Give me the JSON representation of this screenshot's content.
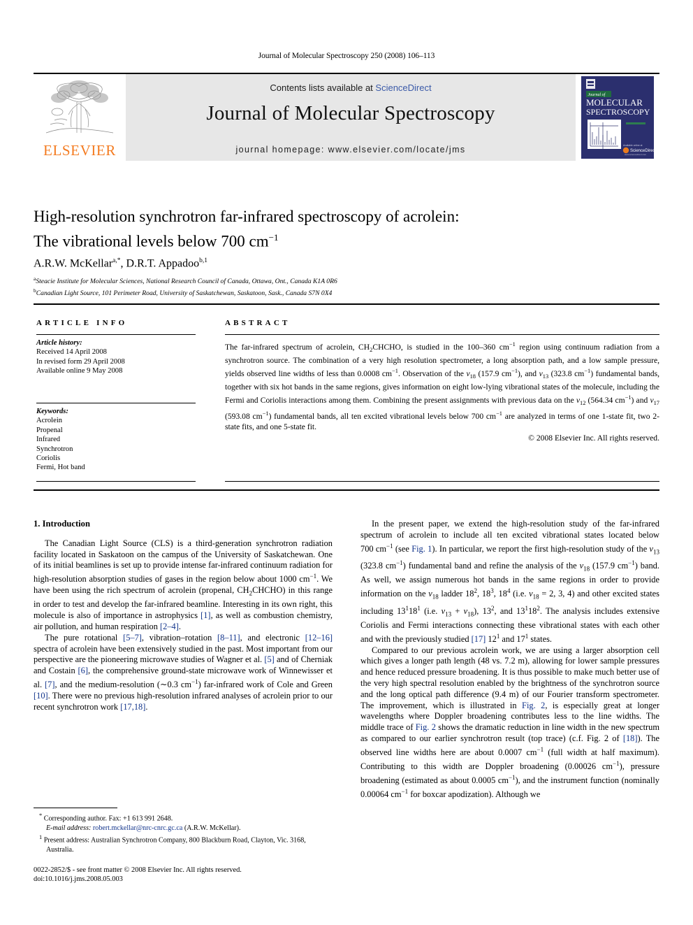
{
  "running_head": "Journal of Molecular Spectroscopy 250 (2008) 106–113",
  "masthead": {
    "publisher_name": "ELSEVIER",
    "contents_prefix": "Contents lists available at ",
    "sciencedirect": "ScienceDirect",
    "journal_title": "Journal of Molecular Spectroscopy",
    "homepage": "journal homepage: www.elsevier.com/locate/jms",
    "cover_journal_of": "Journal of",
    "cover_line1": "MOLECULAR",
    "cover_line2": "SPECTROSCOPY",
    "cover_sciencedirect": "ScienceDirect",
    "accent_orange": "#F47B20",
    "link_blue": "#3B5AA8",
    "cover_navy": "#2b2f6e",
    "band_gray": "#e7e7e7"
  },
  "article": {
    "title_line1": "High-resolution synchrotron far-infrared spectroscopy of acrolein:",
    "title_line2_a": "The vibrational levels below 700 cm",
    "title_line2_sup": "−1",
    "authors": "A.R.W. McKellar",
    "author1_sup": "a,*",
    "author2": ", D.R.T. Appadoo",
    "author2_sup": "b,1",
    "affiliation_a_sup": "a",
    "affiliation_a": "Steacie Institute for Molecular Sciences, National Research Council of Canada, Ottawa, Ont., Canada K1A 0R6",
    "affiliation_b_sup": "b",
    "affiliation_b": "Canadian Light Source, 101 Perimeter Road, University of Saskatchewan, Saskatoon, Sask., Canada S7N 0X4"
  },
  "info": {
    "heading": "ARTICLE INFO",
    "history_label": "Article history:",
    "history": [
      "Received 14 April 2008",
      "In revised form 29 April 2008",
      "Available online 9 May 2008"
    ],
    "keywords_label": "Keywords:",
    "keywords": [
      "Acrolein",
      "Propenal",
      "Infrared",
      "Synchrotron",
      "Coriolis",
      "Fermi, Hot band"
    ]
  },
  "abstract": {
    "heading": "ABSTRACT",
    "copyright": "© 2008 Elsevier Inc. All rights reserved."
  },
  "body": {
    "section_heading": "1. Introduction"
  },
  "footnotes": {
    "corresponding_marker": "*",
    "corresponding": "Corresponding author. Fax: +1 613 991 2648.",
    "email_label": "E-mail address:",
    "email": "robert.mckellar@nrc-cnrc.gc.ca",
    "email_attrib": "(A.R.W. McKellar).",
    "present_marker": "1",
    "present_address": "Present address: Australian Synchrotron Company, 800 Blackburn Road, Clayton, Vic. 3168, Australia."
  },
  "imprint": {
    "issn_line": "0022-2852/$ - see front matter © 2008 Elsevier Inc. All rights reserved.",
    "doi_line": "doi:10.1016/j.jms.2008.05.003"
  }
}
